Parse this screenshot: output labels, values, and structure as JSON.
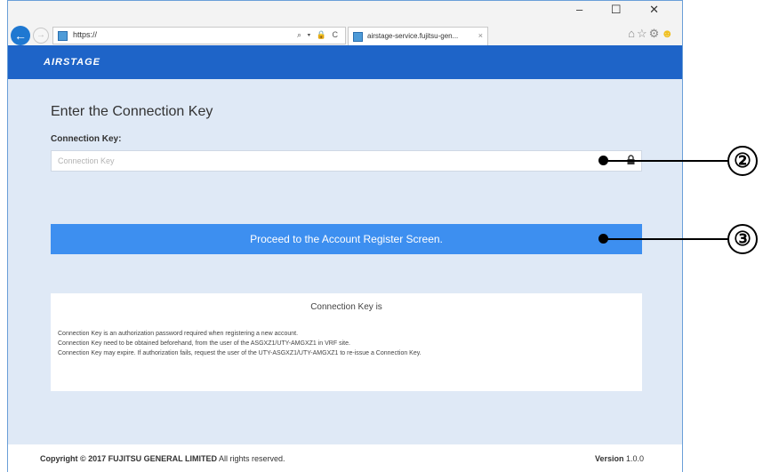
{
  "browser": {
    "url": "https://",
    "tab_title": "airstage-service.fujitsu-gen...",
    "tab_close": "×",
    "address_icons": "⌕ ▾ 🔒 C",
    "window_controls": "– ☐ ✕"
  },
  "header": {
    "logo": "AIRSTAGE"
  },
  "main": {
    "title": "Enter the Connection Key",
    "field_label": "Connection Key:",
    "input_placeholder": "Connection Key",
    "input_value": "",
    "proceed_label": "Proceed to the Account Register Screen."
  },
  "info": {
    "title": "Connection Key is",
    "lines": [
      "Connection Key is an authorization password required when registering a new account.",
      "Connection Key need to be obtained beforehand, from the user of the ASGXZ1/UTY-AMGXZ1 in VRF site.",
      "Connection Key may expire. If authorization fails, request the user of the UTY-ASGXZ1/UTY-AMGXZ1 to re-issue a Connection Key."
    ]
  },
  "footer": {
    "copyright_prefix": "Copyright © 2017 FUJITSU GENERAL LIMITED",
    "copyright_suffix": " All rights reserved.",
    "version_label": "Version",
    "version_number": " 1.0.0"
  },
  "callouts": {
    "key_field": "②",
    "proceed_button": "③"
  },
  "colors": {
    "header_blue": "#1e64c8",
    "button_blue": "#3d8ff0",
    "content_bg": "#dfe9f6"
  }
}
